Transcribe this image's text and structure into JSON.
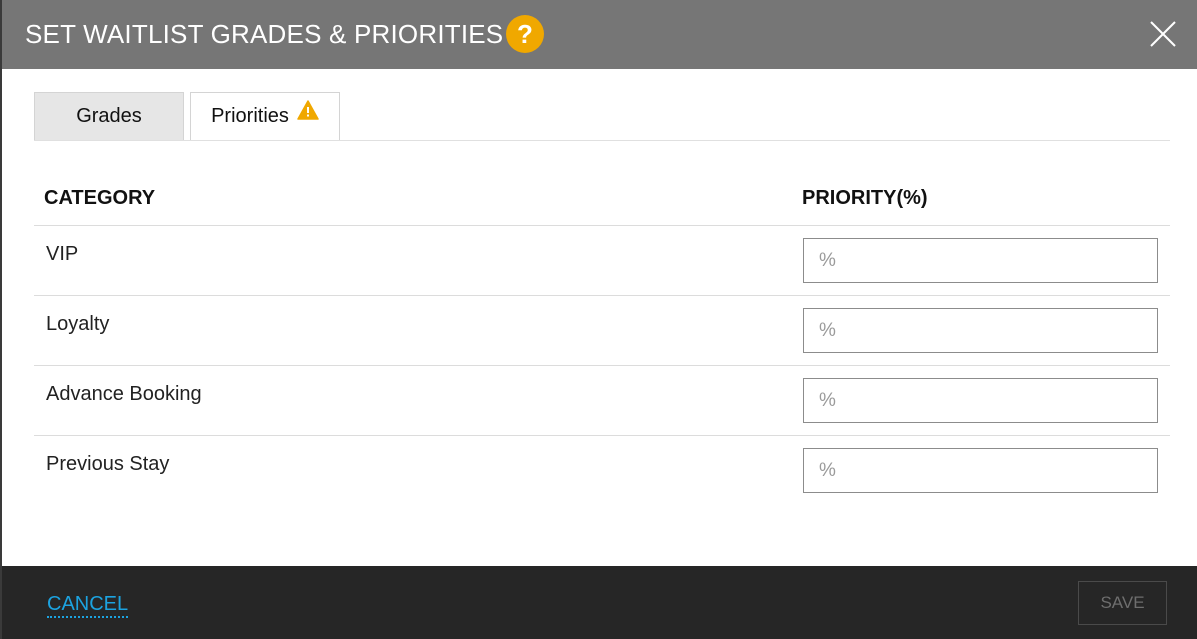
{
  "dialog": {
    "title": "SET WAITLIST GRADES & PRIORITIES",
    "help_glyph": "?",
    "header_color": "#767676",
    "help_color": "#f0a800"
  },
  "tabs": [
    {
      "label": "Grades",
      "active": false
    },
    {
      "label": "Priorities",
      "active": true,
      "warning": true
    }
  ],
  "table": {
    "headers": {
      "category": "CATEGORY",
      "priority": "PRIORITY(%)"
    },
    "rows": [
      {
        "label": "VIP",
        "placeholder": "%",
        "value": ""
      },
      {
        "label": "Loyalty",
        "placeholder": "%",
        "value": ""
      },
      {
        "label": "Advance Booking",
        "placeholder": "%",
        "value": ""
      },
      {
        "label": "Previous Stay",
        "placeholder": "%",
        "value": ""
      }
    ]
  },
  "footer": {
    "cancel_label": "CANCEL",
    "save_label": "SAVE",
    "save_enabled": false,
    "accent_color": "#1ca3e0"
  }
}
